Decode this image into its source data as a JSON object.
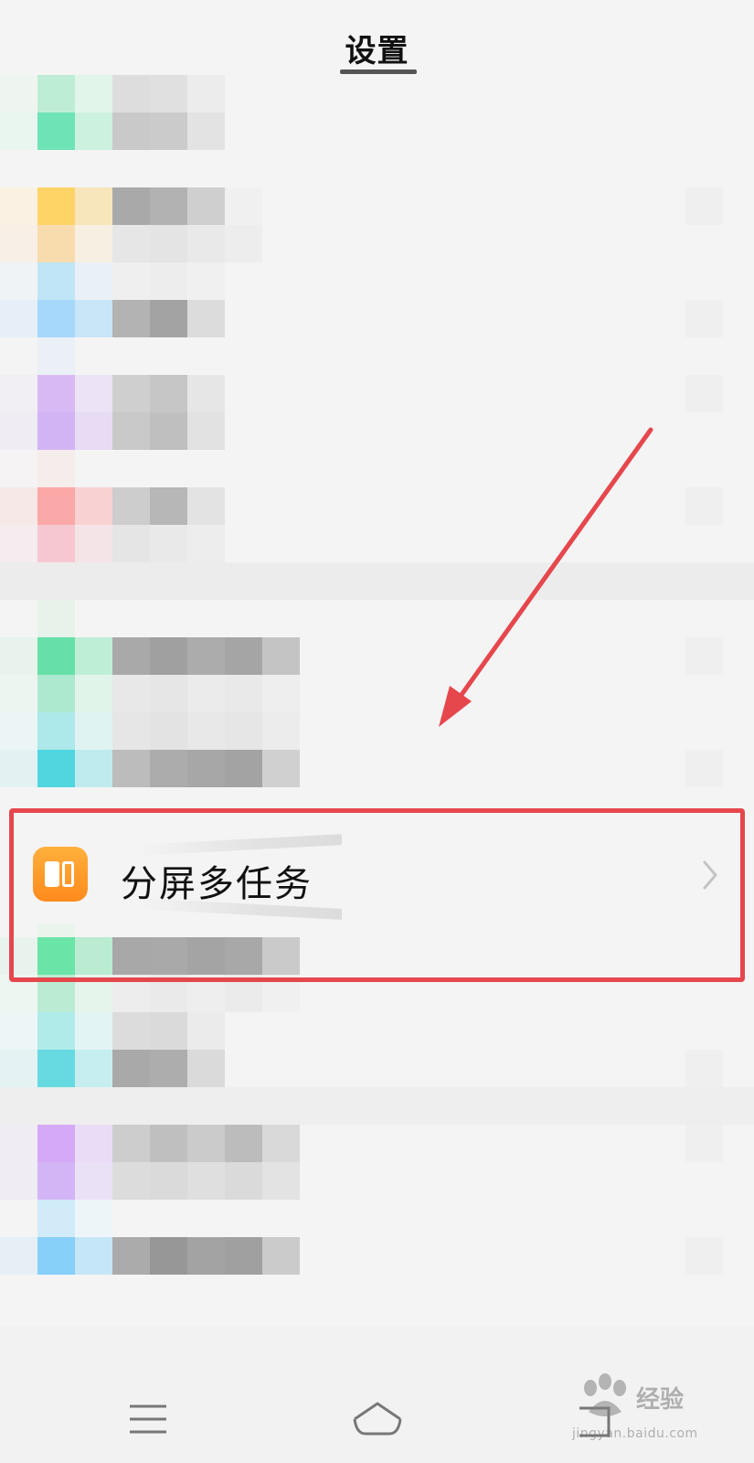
{
  "header": {
    "title": "设置"
  },
  "highlighted_item": {
    "label": "分屏多任务",
    "icon": "split-screen-icon",
    "chevron": "chevron-right-icon"
  },
  "annotation": {
    "highlight_color": "#e5474d",
    "arrow_color": "#e5474d"
  },
  "navbar": {
    "menu_icon": "menu-icon",
    "home_icon": "home-icon",
    "back_icon": "back-icon"
  },
  "watermark": {
    "main": "经验",
    "sub": "jingyan.baidu.com"
  },
  "colors": {
    "background": "#f4f4f4",
    "icon_orange": "#ff9a2a"
  }
}
